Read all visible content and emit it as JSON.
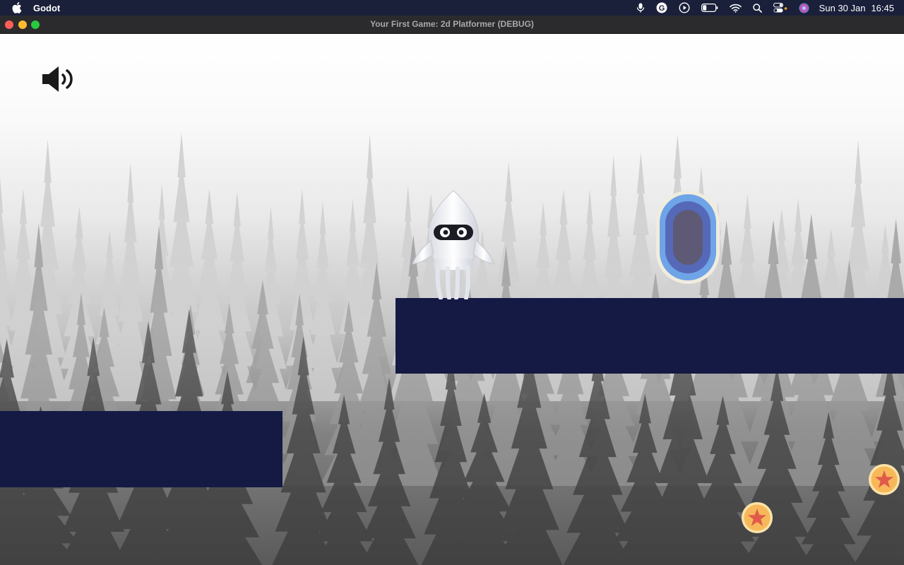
{
  "menubar": {
    "app_name": "Godot",
    "date": "Sun 30 Jan",
    "time": "16:45",
    "icons": [
      "apple-icon",
      "microphone-icon",
      "grammarly-icon",
      "play-icon",
      "battery-icon",
      "wifi-icon",
      "spotlight-search-icon",
      "control-center-icon",
      "siri-icon"
    ]
  },
  "window": {
    "title": "Your First Game: 2d Platformer (DEBUG)"
  },
  "game": {
    "icons": [
      "speaker-icon",
      "squid-player",
      "portal",
      "star-coin"
    ],
    "colors": {
      "platform": "#141a44",
      "coin_fill": "#f7b85a",
      "star": "#e05a4a",
      "portal_outer": "#6fa4e6",
      "portal_inner": "#5e5a76"
    }
  }
}
